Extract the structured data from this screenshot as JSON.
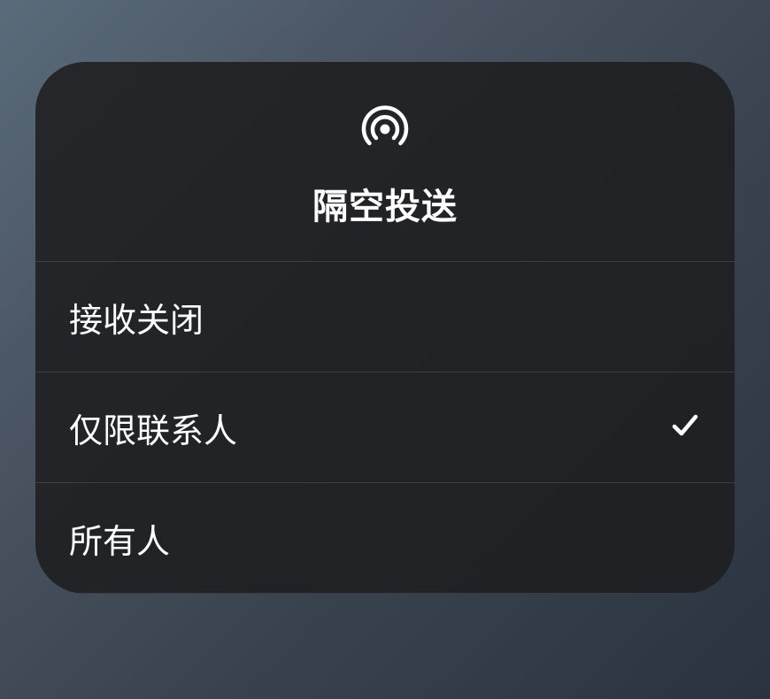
{
  "panel": {
    "title": "隔空投送",
    "icon_name": "airdrop-icon"
  },
  "options": [
    {
      "label": "接收关闭",
      "selected": false
    },
    {
      "label": "仅限联系人",
      "selected": true
    },
    {
      "label": "所有人",
      "selected": false
    }
  ]
}
